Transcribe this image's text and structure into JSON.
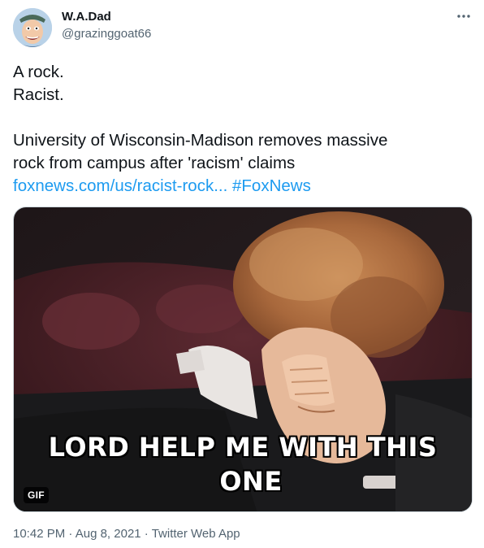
{
  "author": {
    "display_name": "W.A.Dad",
    "handle": "@grazinggoat66",
    "avatar_icon": "cartoon-face-avatar"
  },
  "more_icon": "more-options-icon",
  "tweet": {
    "lines": [
      "A rock.",
      "Racist."
    ],
    "headline_line1": "University of Wisconsin-Madison removes massive",
    "headline_line2": "rock from campus after 'racism' claims",
    "link_text": "foxnews.com/us/racist-rock...",
    "hashtag": "#FoxNews"
  },
  "media": {
    "caption_line1": "LORD HELP ME WITH THIS",
    "caption_line2": "ONE",
    "badge": "GIF"
  },
  "meta": {
    "time": "10:42 PM",
    "separator1": " · ",
    "date": "Aug 8, 2021",
    "separator2": " · ",
    "source": "Twitter Web App"
  },
  "colors": {
    "link": "#1d9bf0",
    "secondary_text": "#536471",
    "primary_text": "#0f1419"
  }
}
